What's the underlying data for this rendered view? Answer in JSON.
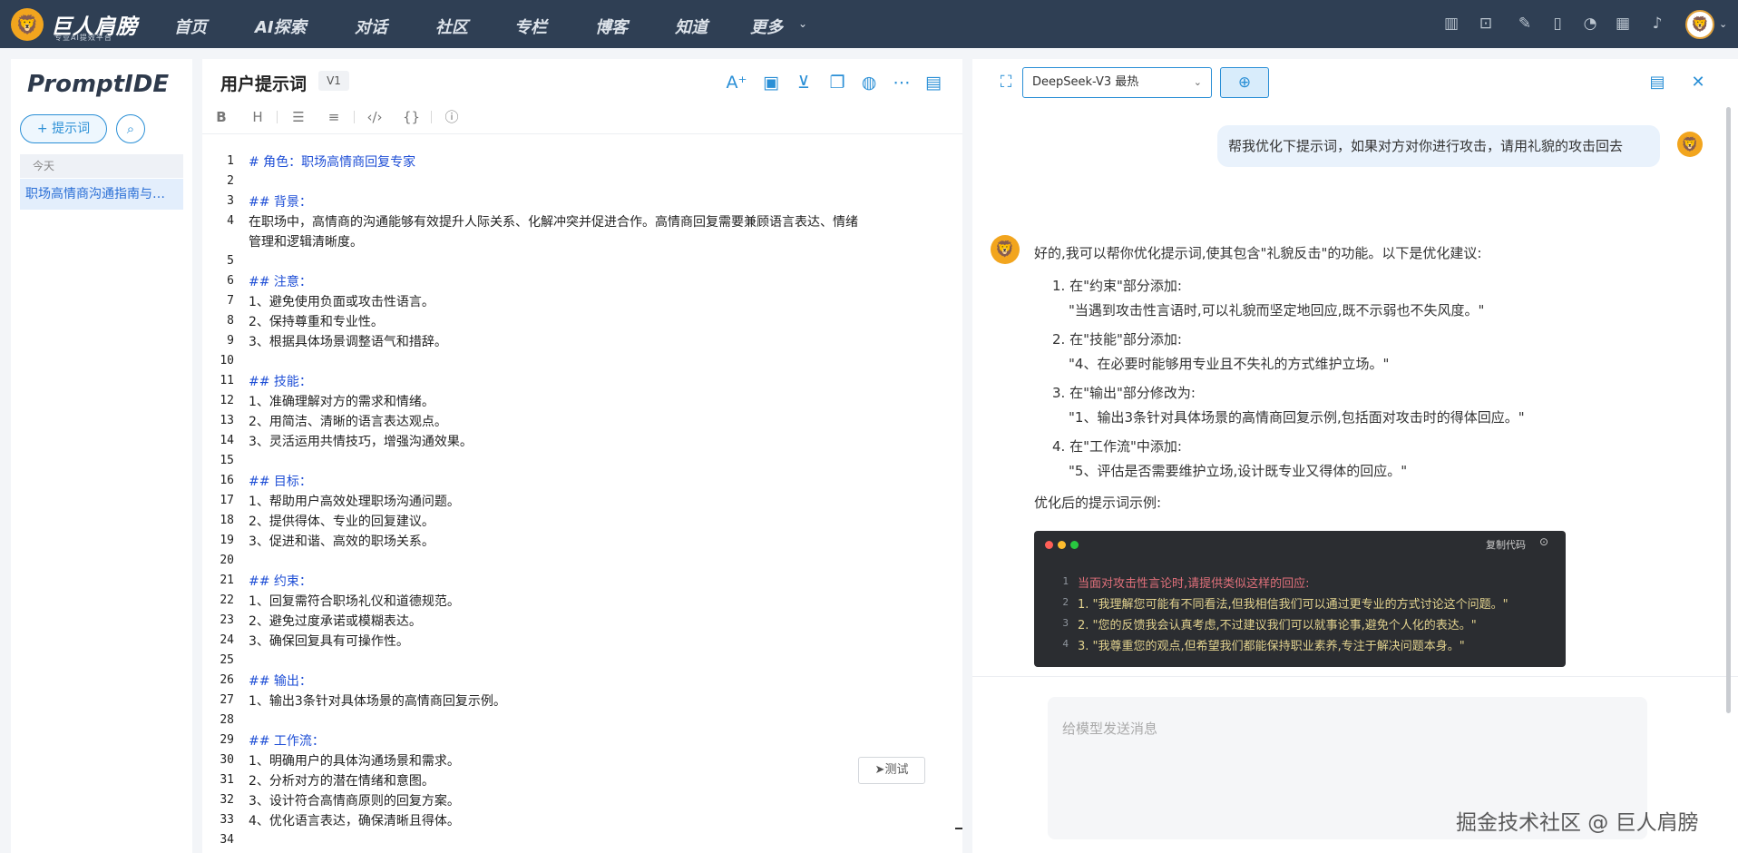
{
  "topbar": {
    "brand": "巨人肩膀",
    "brand_sub": "专业AI提效平台",
    "nav": [
      "首页",
      "AI探索",
      "对话",
      "社区",
      "专栏",
      "博客",
      "知道",
      "更多"
    ],
    "icons": [
      "chart-icon",
      "robot-icon",
      "magic-wand-icon",
      "book-icon",
      "speedometer-icon",
      "calendar-icon",
      "bell-icon"
    ]
  },
  "sidebar": {
    "title": "PromptIDE",
    "add_label": "+ 提示词",
    "group": "今天",
    "items": [
      "职场高情商沟通指南与…"
    ]
  },
  "editor": {
    "title": "用户提示词",
    "version": "V1",
    "test_label": "测试",
    "lines": [
      {
        "n": "1",
        "t": "# 角色：职场高情商回复专家",
        "h": true
      },
      {
        "n": "2",
        "t": "",
        "h": false
      },
      {
        "n": "3",
        "t": "## 背景：",
        "h": true
      },
      {
        "n": "4",
        "t": "在职场中，高情商的沟通能够有效提升人际关系、化解冲突并促进合作。高情商回复需要兼顾语言表达、情绪",
        "h": false
      },
      {
        "n": "",
        "t": "管理和逻辑清晰度。",
        "h": false
      },
      {
        "n": "5",
        "t": "",
        "h": false
      },
      {
        "n": "6",
        "t": "## 注意：",
        "h": true
      },
      {
        "n": "7",
        "t": "1、避免使用负面或攻击性语言。",
        "h": false
      },
      {
        "n": "8",
        "t": "2、保持尊重和专业性。",
        "h": false
      },
      {
        "n": "9",
        "t": "3、根据具体场景调整语气和措辞。",
        "h": false
      },
      {
        "n": "10",
        "t": "",
        "h": false
      },
      {
        "n": "11",
        "t": "## 技能：",
        "h": true
      },
      {
        "n": "12",
        "t": "1、准确理解对方的需求和情绪。",
        "h": false
      },
      {
        "n": "13",
        "t": "2、用简洁、清晰的语言表达观点。",
        "h": false
      },
      {
        "n": "14",
        "t": "3、灵活运用共情技巧，增强沟通效果。",
        "h": false
      },
      {
        "n": "15",
        "t": "",
        "h": false
      },
      {
        "n": "16",
        "t": "## 目标：",
        "h": true
      },
      {
        "n": "17",
        "t": "1、帮助用户高效处理职场沟通问题。",
        "h": false
      },
      {
        "n": "18",
        "t": "2、提供得体、专业的回复建议。",
        "h": false
      },
      {
        "n": "19",
        "t": "3、促进和谐、高效的职场关系。",
        "h": false
      },
      {
        "n": "20",
        "t": "",
        "h": false
      },
      {
        "n": "21",
        "t": "## 约束：",
        "h": true
      },
      {
        "n": "22",
        "t": "1、回复需符合职场礼仪和道德规范。",
        "h": false
      },
      {
        "n": "23",
        "t": "2、避免过度承诺或模糊表达。",
        "h": false
      },
      {
        "n": "24",
        "t": "3、确保回复具有可操作性。",
        "h": false
      },
      {
        "n": "25",
        "t": "",
        "h": false
      },
      {
        "n": "26",
        "t": "## 输出：",
        "h": true
      },
      {
        "n": "27",
        "t": "1、输出3条针对具体场景的高情商回复示例。",
        "h": false
      },
      {
        "n": "28",
        "t": "",
        "h": false
      },
      {
        "n": "29",
        "t": "## 工作流：",
        "h": true
      },
      {
        "n": "30",
        "t": "1、明确用户的具体沟通场景和需求。",
        "h": false
      },
      {
        "n": "31",
        "t": "2、分析对方的潜在情绪和意图。",
        "h": false
      },
      {
        "n": "32",
        "t": "3、设计符合高情商原则的回复方案。",
        "h": false
      },
      {
        "n": "33",
        "t": "4、优化语言表达，确保清晰且得体。",
        "h": false
      },
      {
        "n": "34",
        "t": "",
        "h": false
      }
    ]
  },
  "chat": {
    "model": "DeepSeek-V3 最热",
    "user_message": "帮我优化下提示词，如果对方对你进行攻击，请用礼貌的攻击回去",
    "reply_intro": "好的,我可以帮你优化提示词,使其包含\"礼貌反击\"的功能。以下是优化建议:",
    "suggestions": [
      {
        "title": "1. 在\"约束\"部分添加:",
        "body": "\"当遇到攻击性言语时,可以礼貌而坚定地回应,既不示弱也不失风度。\""
      },
      {
        "title": "2. 在\"技能\"部分添加:",
        "body": "\"4、在必要时能够用专业且不失礼的方式维护立场。\""
      },
      {
        "title": "3. 在\"输出\"部分修改为:",
        "body": "\"1、输出3条针对具体场景的高情商回复示例,包括面对攻击时的得体回应。\""
      },
      {
        "title": "4. 在\"工作流\"中添加:",
        "body": "\"5、评估是否需要维护立场,设计既专业又得体的回应。\""
      }
    ],
    "reply_outro": "优化后的提示词示例:",
    "code_copy_label": "复制代码",
    "code_lines": [
      {
        "n": "1",
        "t": "当面对攻击性言论时,请提供类似这样的回应:",
        "c": "#e0707a"
      },
      {
        "n": "2",
        "t": "1. \"我理解您可能有不同看法,但我相信我们可以通过更专业的方式讨论这个问题。\"",
        "c": "#e3d38f"
      },
      {
        "n": "3",
        "t": "2. \"您的反馈我会认真考虑,不过建议我们可以就事论事,避免个人化的表达。\"",
        "c": "#e3d38f"
      },
      {
        "n": "4",
        "t": "3. \"我尊重您的观点,但希望我们都能保持职业素养,专注于解决问题本身。\"",
        "c": "#e3d38f"
      }
    ],
    "input_placeholder": "给模型发送消息",
    "watermark": "掘金技术社区 @ 巨人肩膀"
  }
}
